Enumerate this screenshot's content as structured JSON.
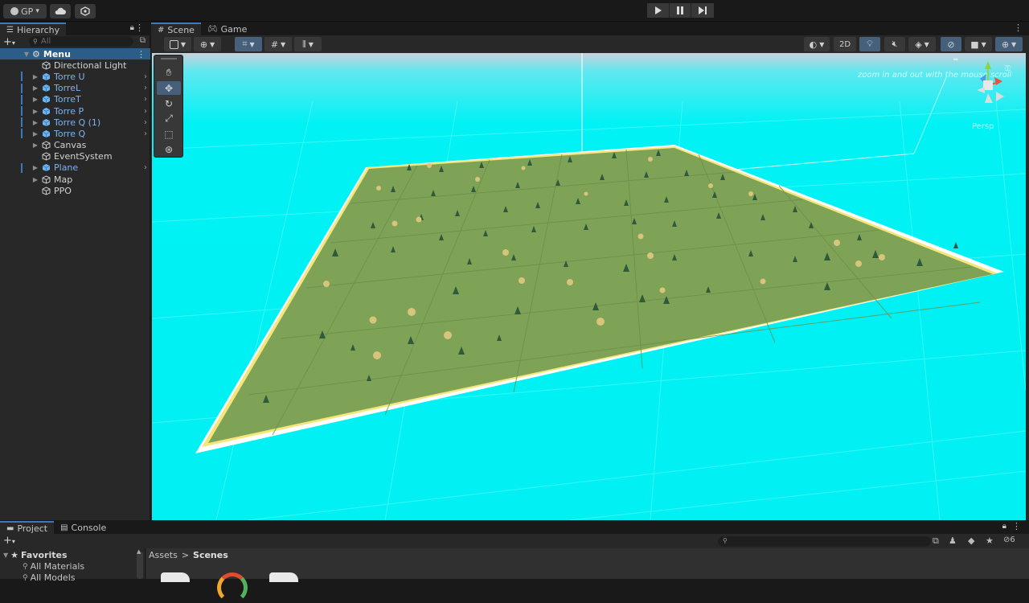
{
  "topbar": {
    "account_label": "GP",
    "account_caret": "▾",
    "play_icon": "play-icon",
    "pause_icon": "pause-icon",
    "step_icon": "step-icon"
  },
  "hierarchy": {
    "tab_label": "Hierarchy",
    "add_label": "+",
    "add_caret": "▾",
    "search_placeholder": "All",
    "scene_name": "Menu",
    "items": [
      {
        "label": "Directional Light"
      },
      {
        "label": "Torre U"
      },
      {
        "label": "TorreL"
      },
      {
        "label": "TorreT"
      },
      {
        "label": "Torre P"
      },
      {
        "label": "Torre Q (1)"
      },
      {
        "label": "Torre Q"
      },
      {
        "label": "Canvas"
      },
      {
        "label": "EventSystem"
      },
      {
        "label": "Plane"
      },
      {
        "label": "Map"
      },
      {
        "label": "PPO"
      }
    ]
  },
  "scene": {
    "tab_scene": "Scene",
    "tab_game": "Game",
    "btn_2d": "2D",
    "overlay_hint": "zoom in and out with the mouse scroll",
    "persp_label": "Persp",
    "colors": {
      "sky": "#00f2f5",
      "ground": "#7ea356",
      "accent": "#3a79bb"
    }
  },
  "project": {
    "tab_project": "Project",
    "tab_console": "Console",
    "add_label": "+",
    "add_caret": "▾",
    "favorites_label": "Favorites",
    "fav_items": [
      "All Materials",
      "All Models"
    ],
    "breadcrumb_root": "Assets",
    "breadcrumb_sep": ">",
    "breadcrumb_current": "Scenes",
    "hidden_count": "6"
  }
}
